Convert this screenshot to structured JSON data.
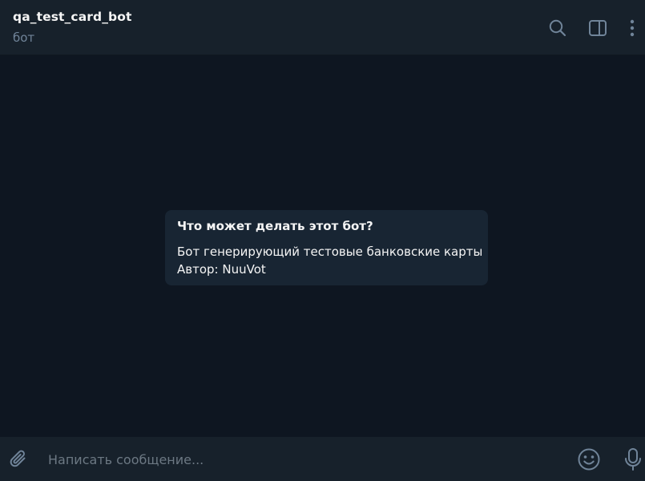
{
  "header": {
    "title": "qa_test_card_bot",
    "subtitle": "бот",
    "icons": [
      "search-icon",
      "sidebar-toggle-icon",
      "more-vertical-icon"
    ]
  },
  "bot_info": {
    "title": "Что может делать этот бот?",
    "description_lines": [
      "Бот генерирующий тестовые банковские карты",
      "Автор: NuuVot"
    ]
  },
  "composer": {
    "placeholder": "Написать сообщение...",
    "value": "",
    "icons": [
      "attach-icon",
      "emoji-icon",
      "microphone-icon"
    ]
  },
  "colors": {
    "background": "#0e1621",
    "header_background": "#17212b",
    "card_background": "#182533",
    "text_primary": "#f5f5f5",
    "text_secondary": "#708499",
    "icon": "#708499"
  }
}
